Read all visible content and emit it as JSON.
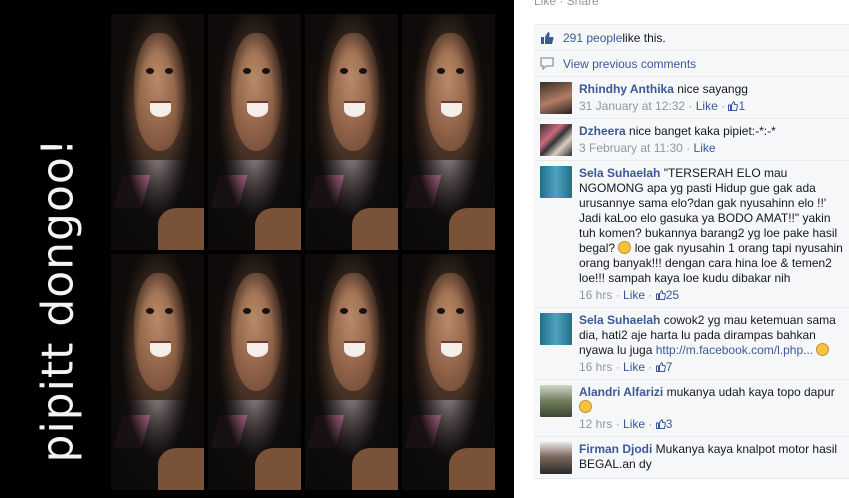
{
  "photo": {
    "caption": "pipitt dongoo!",
    "tiles": [
      1,
      2,
      3,
      4,
      5,
      6,
      7,
      8
    ]
  },
  "sidebar": {
    "top_actions": "Like · Share",
    "likes_count": "291 people",
    "likes_suffix": " like this.",
    "view_previous": "View previous comments"
  },
  "comments": [
    {
      "author": "Rhindhy Anthika",
      "text": " nice sayangg",
      "time": "31 January at 12:32",
      "like": "Like",
      "likes": "1"
    },
    {
      "author": "Dzheera",
      "text": " nice banget kaka pipiet:-*:-*",
      "time": "3 February at 11:30",
      "like": "Like",
      "likes": ""
    },
    {
      "author": "Sela Suhaelah",
      "text": " \"TERSERAH ELO mau NGOMONG apa yg pasti Hidup gue gak ada urusannye sama elo?dan gak nyusahinn elo !!' Jadi kaLoo elo gasuka ya BODO AMAT!!\" yakin tuh komen? bukannya barang2 yg loe pake hasil begal? ",
      "text2": " loe gak nyusahin 1 orang tapi nyusahin orang banyak!!! dengan cara hina loe & temen2 loe!!! sampah kaya loe kudu dibakar nih",
      "time": "16 hrs",
      "like": "Like",
      "likes": "25"
    },
    {
      "author": "Sela Suhaelah",
      "text": " cowok2 yg mau ketemuan sama dia, hati2 aje harta lu pada dirampas bahkan nyawa lu juga ",
      "link": "http://m.facebook.com/l.php...",
      "time": "16 hrs",
      "like": "Like",
      "likes": "7"
    },
    {
      "author": "Alandri Alfarizi",
      "text": " mukanya udah kaya topo dapur",
      "time": "12 hrs",
      "like": "Like",
      "likes": "3"
    },
    {
      "author": "Firman Djodi",
      "text": " Mukanya kaya knalpot motor hasil BEGAL.an dy",
      "time": "",
      "like": "",
      "likes": ""
    }
  ],
  "colors": {
    "link": "#3b5998",
    "muted": "#9197a3",
    "panel": "#f6f7f9"
  }
}
